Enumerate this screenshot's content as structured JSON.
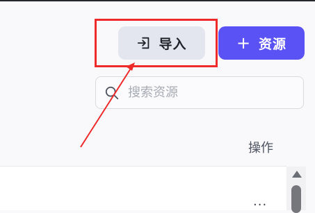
{
  "toolbar": {
    "import_label": "导入",
    "import_icon": "import-icon",
    "add_icon": "plus-icon",
    "add_label": "资源"
  },
  "search": {
    "placeholder": "搜索资源",
    "icon": "search-icon"
  },
  "table": {
    "columns": [
      "操作"
    ],
    "rows": [
      {
        "action": "..."
      }
    ]
  },
  "annotation": {
    "color": "#ee2a2a"
  },
  "colors": {
    "primary": "#5a52f5",
    "secondary_button": "#e4e6ef"
  }
}
